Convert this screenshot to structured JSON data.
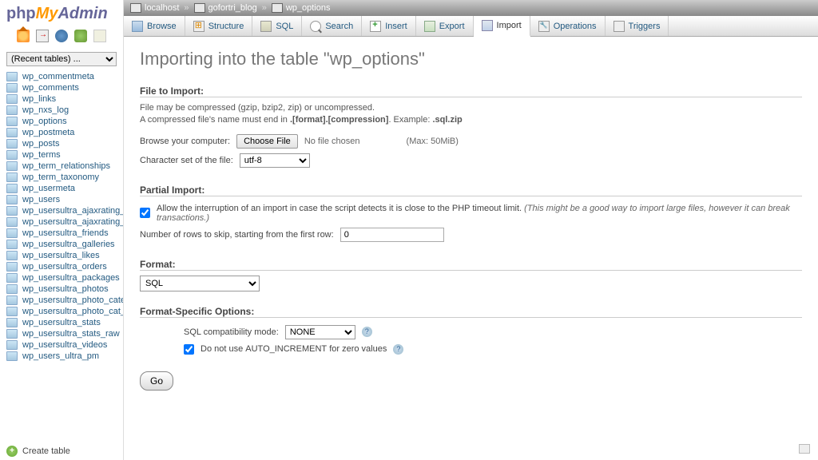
{
  "logo": {
    "p1": "php",
    "p2": "My",
    "p3": "Admin"
  },
  "recent_placeholder": "(Recent tables) ...",
  "tables": [
    "wp_commentmeta",
    "wp_comments",
    "wp_links",
    "wp_nxs_log",
    "wp_options",
    "wp_postmeta",
    "wp_posts",
    "wp_terms",
    "wp_term_relationships",
    "wp_term_taxonomy",
    "wp_usermeta",
    "wp_users",
    "wp_usersultra_ajaxrating_vot",
    "wp_usersultra_ajaxrating_vot",
    "wp_usersultra_friends",
    "wp_usersultra_galleries",
    "wp_usersultra_likes",
    "wp_usersultra_orders",
    "wp_usersultra_packages",
    "wp_usersultra_photos",
    "wp_usersultra_photo_categor",
    "wp_usersultra_photo_cat_rel",
    "wp_usersultra_stats",
    "wp_usersultra_stats_raw",
    "wp_usersultra_videos",
    "wp_users_ultra_pm"
  ],
  "create_table": "Create table",
  "breadcrumb": {
    "host": "localhost",
    "db": "gofortri_blog",
    "table": "wp_options"
  },
  "tabs": {
    "browse": "Browse",
    "structure": "Structure",
    "sql": "SQL",
    "search": "Search",
    "insert": "Insert",
    "export": "Export",
    "import": "Import",
    "operations": "Operations",
    "triggers": "Triggers"
  },
  "title": "Importing into the table \"wp_options\"",
  "file": {
    "legend": "File to Import:",
    "hint1": "File may be compressed (gzip, bzip2, zip) or uncompressed.",
    "hint2a": "A compressed file's name must end in ",
    "hint2b": ".[format].[compression]",
    "hint2c": ". Example: ",
    "hint2d": ".sql.zip",
    "browse_label": "Browse your computer:",
    "choose_file": "Choose File",
    "no_file": "No file chosen",
    "max": "(Max: 50MiB)",
    "charset_label": "Character set of the file:",
    "charset_value": "utf-8"
  },
  "partial": {
    "legend": "Partial Import:",
    "allow": "Allow the interruption of an import in case the script detects it is close to the PHP timeout limit. ",
    "allow_hint": "(This might be a good way to import large files, however it can break transactions.)",
    "skip_label": "Number of rows to skip, starting from the first row:",
    "skip_value": "0"
  },
  "format": {
    "legend": "Format:",
    "value": "SQL"
  },
  "fso": {
    "legend": "Format-Specific Options:",
    "compat_label": "SQL compatibility mode:",
    "compat_value": "NONE",
    "auto_label_a": "Do not use ",
    "auto_label_b": "AUTO_INCREMENT",
    "auto_label_c": " for zero values"
  },
  "go": "Go"
}
